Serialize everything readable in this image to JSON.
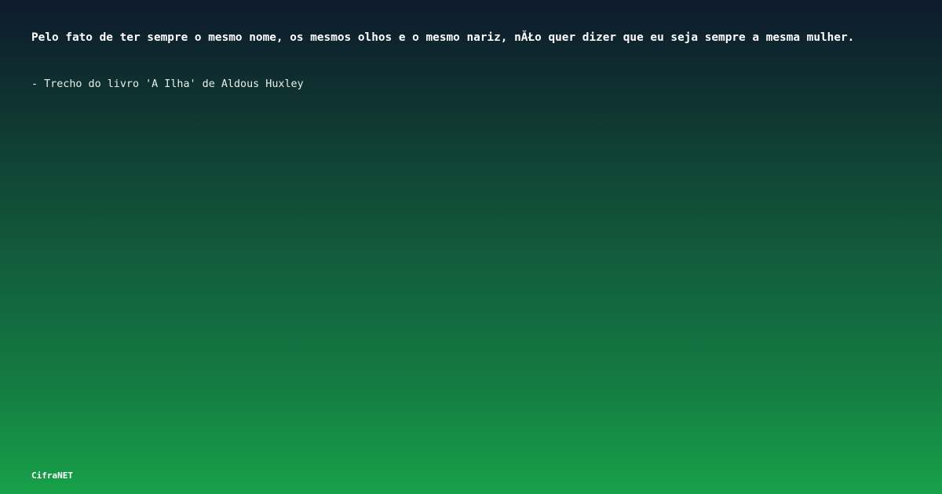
{
  "quote": {
    "text": "Pelo fato de ter sempre o mesmo nome, os mesmos olhos e o mesmo nariz, nĂŁo quer dizer que eu seja sempre a mesma mulher.",
    "attribution": "- Trecho do livro 'A Ilha' de Aldous Huxley"
  },
  "brand": {
    "name": "CifraNET"
  },
  "colors": {
    "background_top": "#0e1a2d",
    "background_bottom": "#17a148",
    "text": "#ffffff"
  }
}
